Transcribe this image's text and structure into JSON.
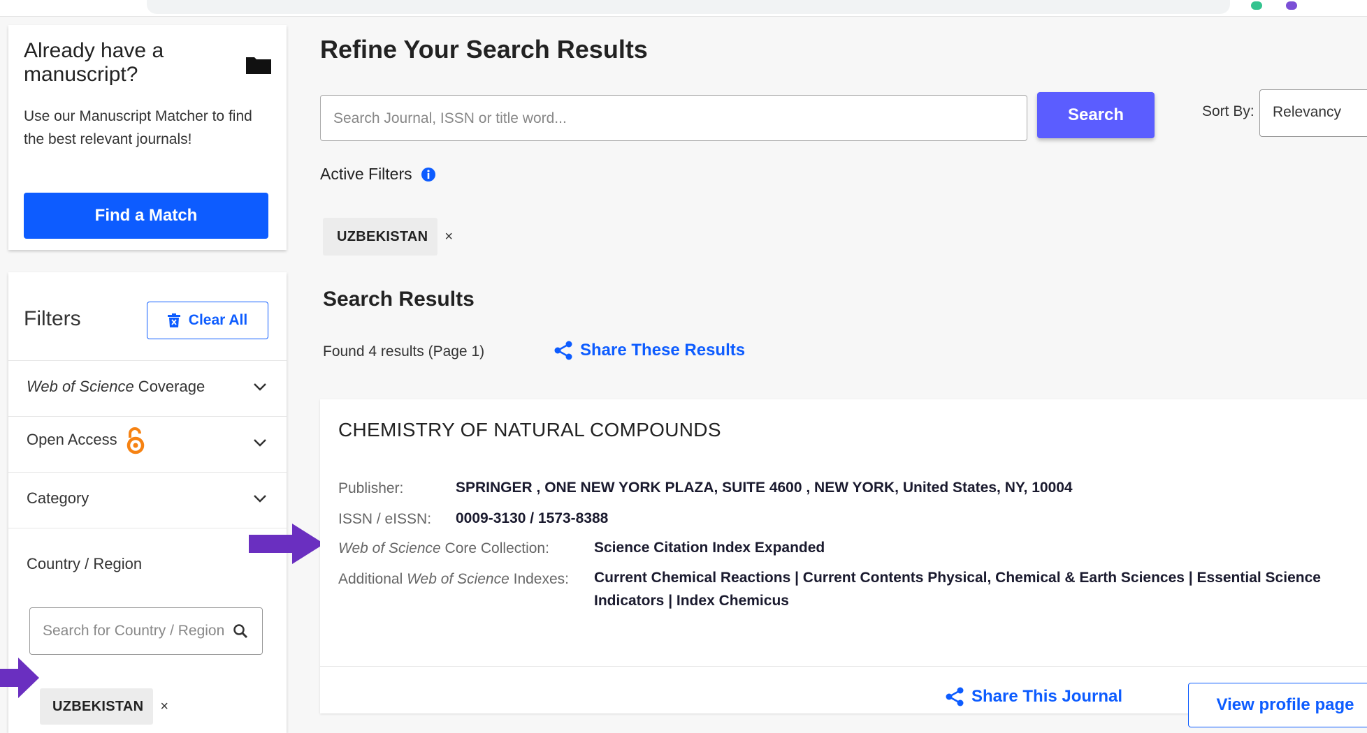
{
  "matcher": {
    "title": "Already have a manuscript?",
    "description": "Use our Manuscript Matcher to find the best relevant journals!",
    "button": "Find a Match"
  },
  "filters": {
    "title": "Filters",
    "clear_all": "Clear All",
    "items": [
      {
        "label_italic": "Web of Science",
        "label_rest": " Coverage"
      },
      {
        "label": "Open Access"
      },
      {
        "label": "Category"
      },
      {
        "label": "Country / Region"
      }
    ],
    "country_search_placeholder": "Search for Country / Region",
    "selected_country": "UZBEKISTAN",
    "chip_close": "×"
  },
  "main": {
    "title": "Refine Your Search Results",
    "search_placeholder": "Search Journal, ISSN or title word...",
    "search_button": "Search",
    "sort_label": "Sort By:",
    "sort_value": "Relevancy",
    "active_filters_label": "Active Filters",
    "active_filter_chip": "UZBEKISTAN",
    "results_title": "Search Results",
    "found_text": "Found 4 results (Page 1)",
    "share_results": "Share These Results"
  },
  "result": {
    "journal_title": "CHEMISTRY OF NATURAL COMPOUNDS",
    "publisher_label": "Publisher:",
    "publisher_value": "SPRINGER , ONE NEW YORK PLAZA, SUITE 4600 , NEW YORK, United States, NY, 10004",
    "issn_label": "ISSN / eISSN:",
    "issn_value": "0009-3130 / 1573-8388",
    "core_label_italic": "Web of Science",
    "core_label_rest": " Core Collection:",
    "core_value": "Science Citation Index Expanded",
    "additional_label_pre": "Additional ",
    "additional_label_italic": "Web of Science",
    "additional_label_post": " Indexes:",
    "additional_value": "Current Chemical Reactions | Current Contents Physical, Chemical & Earth Sciences | Essential Science Indicators | Index Chemicus",
    "share_journal": "Share This Journal",
    "view_profile": "View profile page"
  },
  "colors": {
    "accent_blue": "#0d5cff",
    "search_button": "#5b5dff",
    "annotation_arrow": "#6a2fc0"
  }
}
